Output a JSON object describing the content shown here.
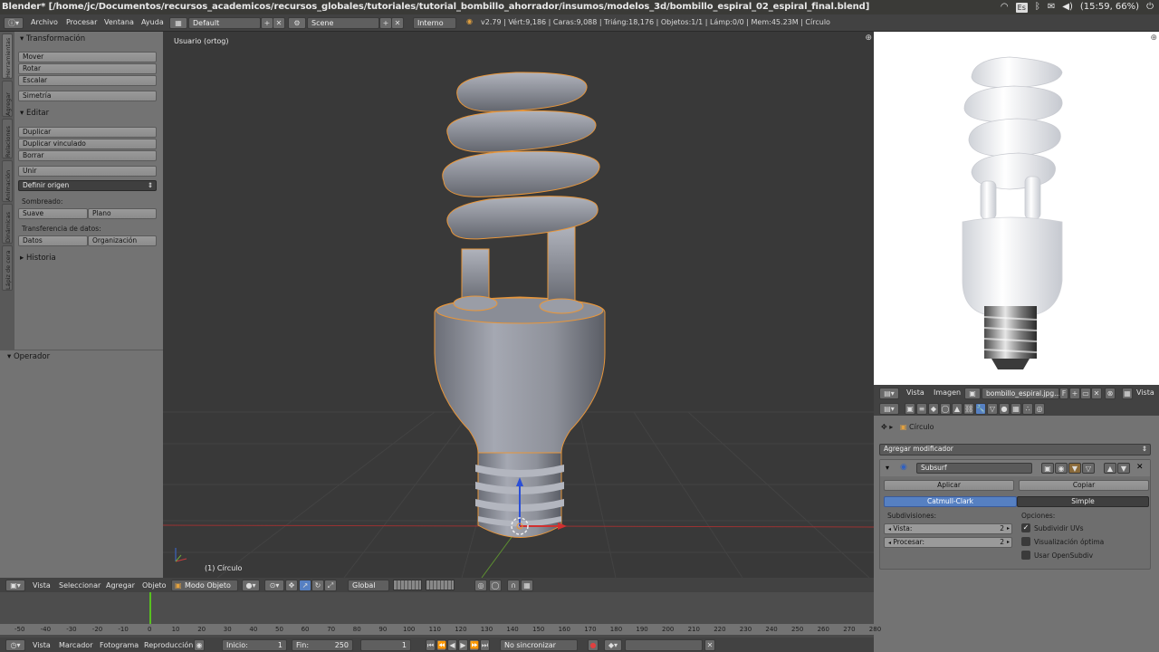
{
  "window_title": "Blender* [/home/jc/Documentos/recursos_academicos/recursos_globales/tutoriales/tutorial_bombillo_ahorrador/insumos/modelos_3d/bombillo_espiral_02_espiral_final.blend]",
  "os_tray": {
    "lang": "Es",
    "clock": "(15:59, 66%)"
  },
  "info_menu": [
    "Archivo",
    "Procesar",
    "Ventana",
    "Ayuda"
  ],
  "screen_layout": "Default",
  "scene": "Scene",
  "render_engine": "Interno",
  "stats": "v2.79 | Vért:9,186 | Caras:9,088 | Triáng:18,176 | Objetos:1/1 | Lámp:0/0 | Mem:45.23M | Círculo",
  "tool_tabs": [
    "Herramientas",
    "Agregar",
    "Relaciones",
    "Animación",
    "Dinámicas",
    "Lápiz de cera"
  ],
  "toolshelf": {
    "transform_header": "Transformación",
    "transform": [
      "Mover",
      "Rotar",
      "Escalar",
      "Simetría"
    ],
    "edit_header": "Editar",
    "edit": [
      "Duplicar",
      "Duplicar vinculado",
      "Borrar",
      "Unir"
    ],
    "set_origin": "Definir origen",
    "shading_label": "Sombreado:",
    "shading": [
      "Suave",
      "Plano"
    ],
    "data_transfer_label": "Transferencia de datos:",
    "data_transfer": [
      "Datos",
      "Organización"
    ],
    "history_header": "Historia",
    "operator_header": "Operador"
  },
  "viewport": {
    "view_name": "Usuario (ortog)",
    "object_label": "(1) Círculo"
  },
  "image_editor": {
    "menu": [
      "Vista",
      "Imagen"
    ],
    "image_name": "bombillo_espiral.jpg...",
    "image_flag": "F",
    "view_label": "Vista"
  },
  "properties": {
    "breadcrumb": "Círculo",
    "add_modifier": "Agregar modificador",
    "modifier_name": "Subsurf",
    "apply": "Aplicar",
    "copy": "Copiar",
    "algorithms": [
      "Catmull-Clark",
      "Simple"
    ],
    "subdivisions_label": "Subdivisiones:",
    "view_label": "Vista:",
    "view_value": "2",
    "render_label": "Procesar:",
    "render_value": "2",
    "options_label": "Opciones:",
    "options": [
      {
        "label": "Subdividir UVs",
        "checked": true
      },
      {
        "label": "Visualización óptima",
        "checked": false
      },
      {
        "label": "Usar OpenSubdiv",
        "checked": false
      }
    ]
  },
  "view3d_header": {
    "menu": [
      "Vista",
      "Seleccionar",
      "Agregar",
      "Objeto"
    ],
    "mode": "Modo Objeto",
    "orientation": "Global"
  },
  "timeline": {
    "ticks": [
      "-50",
      "-40",
      "-30",
      "-20",
      "-10",
      "0",
      "10",
      "20",
      "30",
      "40",
      "50",
      "60",
      "70",
      "80",
      "90",
      "100",
      "110",
      "120",
      "130",
      "140",
      "150",
      "160",
      "170",
      "180",
      "190",
      "200",
      "210",
      "220",
      "230",
      "240",
      "250",
      "260",
      "270",
      "280"
    ],
    "current_frame": 0,
    "menu": [
      "Vista",
      "Marcador",
      "Fotograma",
      "Reproducción"
    ],
    "start_label": "Inicio:",
    "start_value": "1",
    "end_label": "Fin:",
    "end_value": "250",
    "frame_value": "1",
    "sync": "No sincronizar"
  },
  "colors": {
    "selection_outline": "#e8963a",
    "accent_blue": "#5680c2",
    "x_axis": "#c83c3c",
    "y_axis": "#6fa83a"
  }
}
